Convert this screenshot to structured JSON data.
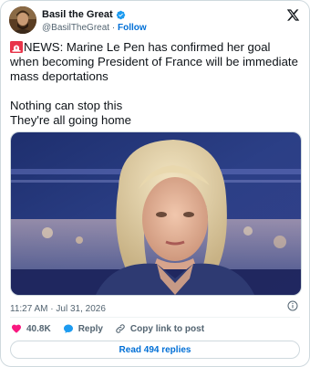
{
  "author": {
    "display_name": "Basil the Great",
    "handle": "@BasilTheGreat",
    "separator": "·",
    "follow_label": "Follow",
    "verified": true
  },
  "tweet": {
    "line1": "NEWS: Marine Le Pen has confirmed her goal when becoming President of France will be immediate mass deportations",
    "line2": "Nothing can stop this",
    "line3": "They're all going home",
    "leading_emoji": "siren-icon"
  },
  "media": {
    "kind": "photo",
    "subject": "portrait"
  },
  "meta": {
    "timestamp": "11:27 AM · Jul 31, 2026"
  },
  "actions": {
    "likes": "40.8K",
    "reply_label": "Reply",
    "copy_link_label": "Copy link to post"
  },
  "read_replies_label": "Read 494 replies",
  "colors": {
    "link": "#006fd6",
    "secondary_text": "#536471",
    "heart": "#f91880",
    "reply": "#1d9bf0",
    "border": "#cfd9de"
  }
}
